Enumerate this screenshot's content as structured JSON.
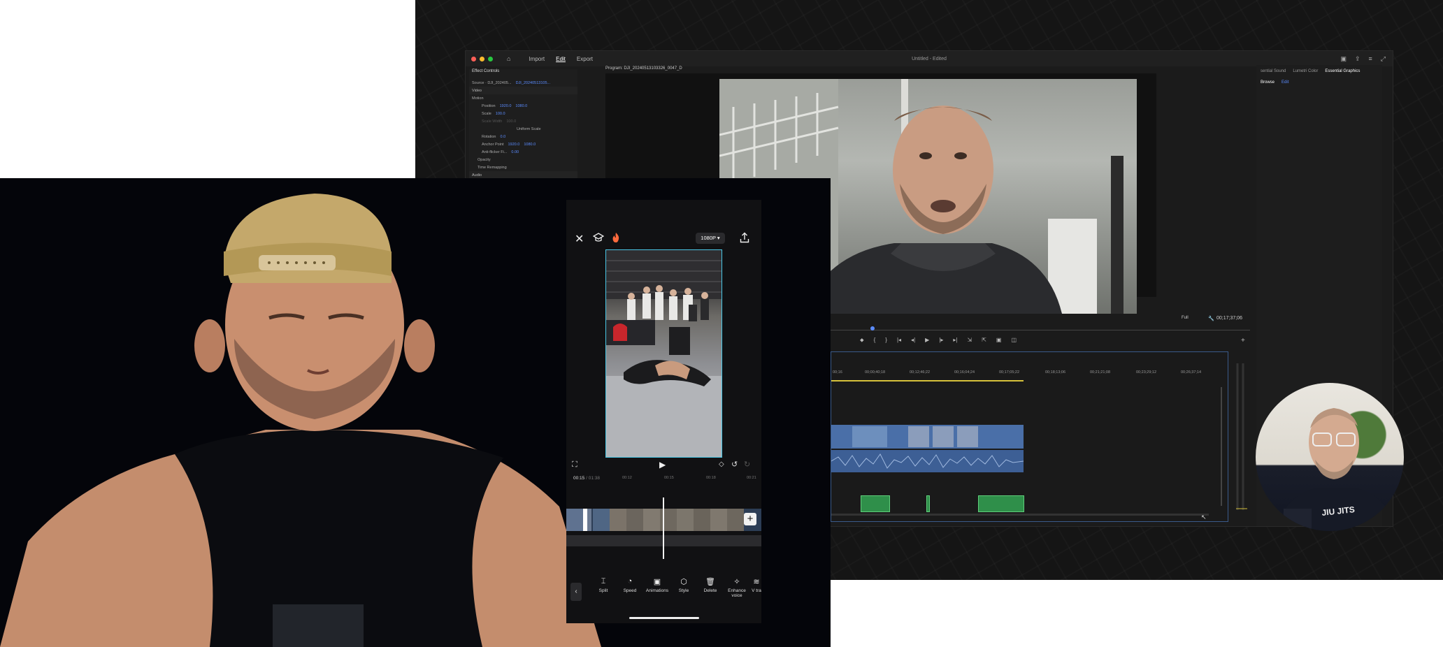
{
  "premiere": {
    "window_title": "Untitled - Edited",
    "menu": [
      "Import",
      "Edit",
      "Export"
    ],
    "active_menu": "Edit",
    "effect_controls": {
      "tab": "Effect Controls",
      "source_label": "Source · DJI_202405...",
      "source_clip": "DJI_20240513105...",
      "rows": [
        {
          "name": "Video",
          "value1": "",
          "value2": ""
        },
        {
          "name": "Motion",
          "value1": "",
          "value2": ""
        },
        {
          "name": "Position",
          "value1": "1920.0",
          "value2": "1080.0"
        },
        {
          "name": "Scale",
          "value1": "100.0",
          "value2": ""
        },
        {
          "name": "Scale Width",
          "value1": "100.0",
          "value2": ""
        },
        {
          "name": "Uniform Scale",
          "value1": "",
          "value2": ""
        },
        {
          "name": "Rotation",
          "value1": "0.0",
          "value2": ""
        },
        {
          "name": "Anchor Point",
          "value1": "1920.0",
          "value2": "1080.0"
        },
        {
          "name": "Anti-flicker Fi...",
          "value1": "0.00",
          "value2": ""
        },
        {
          "name": "Opacity",
          "value1": "",
          "value2": ""
        },
        {
          "name": "Time Remapping",
          "value1": "",
          "value2": ""
        },
        {
          "name": "Audio",
          "value1": "",
          "value2": ""
        }
      ]
    },
    "program_tab": "Program: DJI_20240513103326_0047_D",
    "fit_label": "Full",
    "timecode": "00;17;37;06",
    "ruler_ticks": [
      "00;16",
      "00;00;40;18",
      "00;12;46;22",
      "00;16;04;24",
      "00;17;05;22",
      "00;18;13;06",
      "00;21;21;08",
      "00;23;29;12",
      "00;26;37;14"
    ],
    "panels": {
      "right_tabs": [
        "sential Sound",
        "Lumetri Color",
        "Essential Graphics"
      ],
      "active_right_tab": "Essential Graphics",
      "sub_tabs": [
        "Browse",
        "Edit"
      ]
    }
  },
  "capcut": {
    "resolution": "1080P",
    "current_time": "00:15",
    "total_time": "01:38",
    "ticks": [
      "00:12",
      "00:15",
      "00:18",
      "00:21"
    ],
    "tools": [
      {
        "label": "Split",
        "icon": "split-icon",
        "glyph": "⌶"
      },
      {
        "label": "Speed",
        "icon": "speed-icon",
        "glyph": "◔"
      },
      {
        "label": "Animations",
        "icon": "animations-icon",
        "glyph": "▶"
      },
      {
        "label": "Style",
        "icon": "style-icon",
        "glyph": "⬡"
      },
      {
        "label": "Delete",
        "icon": "delete-icon",
        "glyph": "␡"
      },
      {
        "label": "Enhance voice",
        "icon": "enhance-voice-icon",
        "glyph": "⚕"
      },
      {
        "label": "V tra",
        "icon": "voice-transform-icon",
        "glyph": "≡"
      }
    ]
  },
  "colors": {
    "accent_blue": "#4ac7e6",
    "premiere_blue": "#5b8cff",
    "timeline_yellow": "#d6c23b",
    "clip_green": "#2f8f4a"
  }
}
